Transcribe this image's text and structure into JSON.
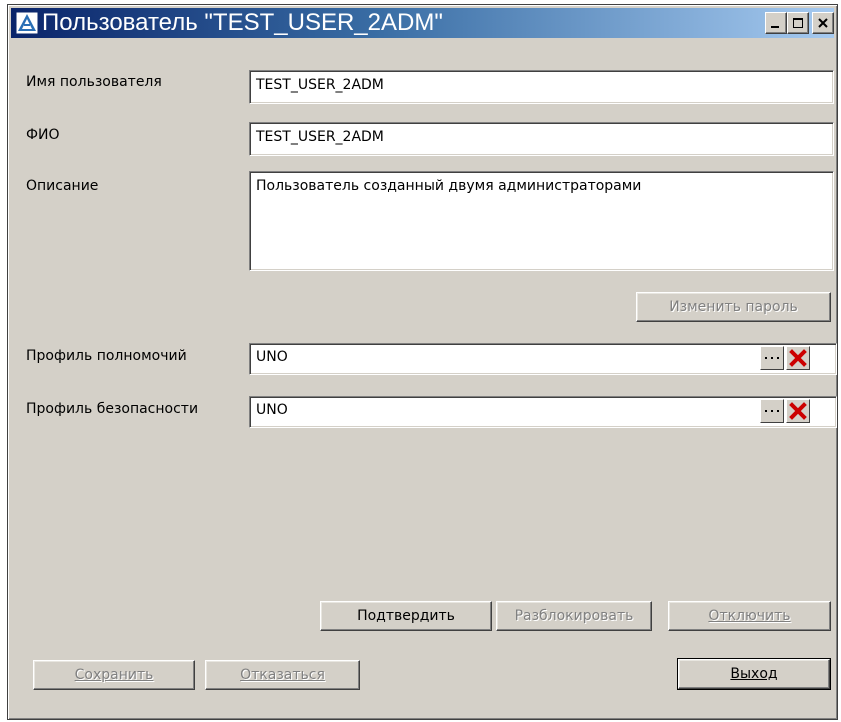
{
  "window": {
    "title": "Пользователь \"TEST_USER_2ADM\"",
    "controls": [
      "minimize-icon",
      "maximize-icon",
      "close-icon"
    ]
  },
  "form": {
    "username": {
      "label": "Имя пользователя",
      "value": "TEST_USER_2ADM"
    },
    "fullname": {
      "label": "ФИО",
      "value": "TEST_USER_2ADM"
    },
    "description": {
      "label": "Описание",
      "value": "Пользователь созданный двумя администраторами"
    },
    "change_password_label": "Изменить пароль",
    "authority_profile": {
      "label": "Профиль полномочий",
      "value": "UNO"
    },
    "security_profile": {
      "label": "Профиль безопасности",
      "value": "UNO"
    }
  },
  "actions": {
    "confirm": "Подтвердить",
    "unlock": "Разблокировать",
    "disable": "Отключить",
    "save": "Сохранить",
    "cancel": "Отказаться",
    "exit": "Выход"
  },
  "colors": {
    "window_bg": "#d4d0c8",
    "titlebar_start": "#0a246a",
    "titlebar_end": "#a6caf0",
    "clear_red": "#cc0000"
  }
}
